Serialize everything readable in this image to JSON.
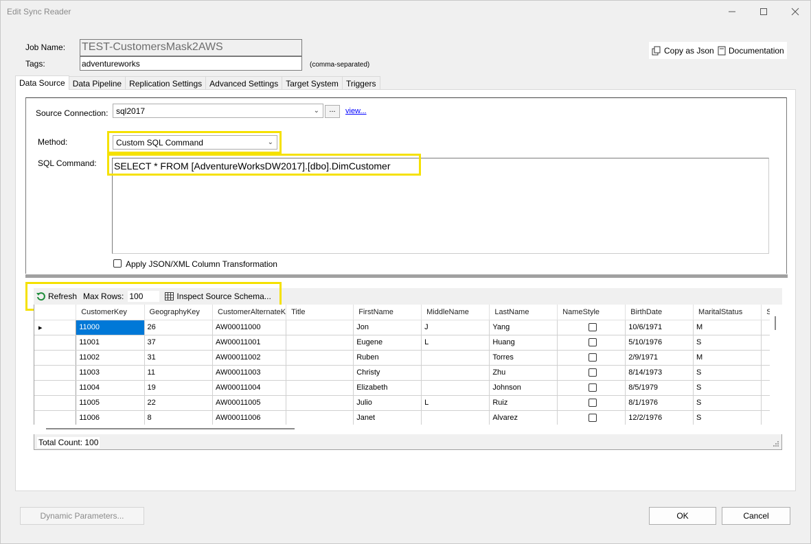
{
  "window": {
    "title": "Edit Sync Reader"
  },
  "form": {
    "job_name_label": "Job Name:",
    "job_name_value": "TEST-CustomersMask2AWS",
    "tags_label": "Tags:",
    "tags_value": "adventureworks",
    "tags_hint": "(comma-separated)",
    "copy_json_label": "Copy as Json",
    "documentation_label": "Documentation"
  },
  "tabs": [
    {
      "label": "Data Source",
      "active": true
    },
    {
      "label": "Data Pipeline"
    },
    {
      "label": "Replication Settings"
    },
    {
      "label": "Advanced Settings"
    },
    {
      "label": "Target System"
    },
    {
      "label": "Triggers"
    }
  ],
  "source": {
    "connection_label": "Source Connection:",
    "connection_value": "sql2017",
    "browse_label": "...",
    "view_link": "view...",
    "method_label": "Method:",
    "method_value": "Custom SQL Command",
    "sql_label": "SQL Command:",
    "sql_value": "SELECT * FROM [AdventureWorksDW2017].[dbo].DimCustomer",
    "transform_label": "Apply JSON/XML Column Transformation"
  },
  "toolbar": {
    "refresh_label": "Refresh",
    "max_rows_label": "Max Rows:",
    "max_rows_value": "100",
    "inspect_label": "Inspect Source Schema..."
  },
  "grid": {
    "columns": [
      "CustomerKey",
      "GeographyKey",
      "CustomerAlternateK",
      "Title",
      "FirstName",
      "MiddleName",
      "LastName",
      "NameStyle",
      "BirthDate",
      "MaritalStatus",
      "S"
    ],
    "rows": [
      [
        "11000",
        "26",
        "AW00011000",
        "",
        "Jon",
        "J",
        "Yang",
        "",
        "10/6/1971",
        "M",
        ""
      ],
      [
        "11001",
        "37",
        "AW00011001",
        "",
        "Eugene",
        "L",
        "Huang",
        "",
        "5/10/1976",
        "S",
        ""
      ],
      [
        "11002",
        "31",
        "AW00011002",
        "",
        "Ruben",
        "",
        "Torres",
        "",
        "2/9/1971",
        "M",
        ""
      ],
      [
        "11003",
        "11",
        "AW00011003",
        "",
        "Christy",
        "",
        "Zhu",
        "",
        "8/14/1973",
        "S",
        ""
      ],
      [
        "11004",
        "19",
        "AW00011004",
        "",
        "Elizabeth",
        "",
        "Johnson",
        "",
        "8/5/1979",
        "S",
        ""
      ],
      [
        "11005",
        "22",
        "AW00011005",
        "",
        "Julio",
        "L",
        "Ruiz",
        "",
        "8/1/1976",
        "S",
        ""
      ],
      [
        "11006",
        "8",
        "AW00011006",
        "",
        "Janet",
        "",
        "Alvarez",
        "",
        "12/2/1976",
        "S",
        ""
      ]
    ],
    "total_count": "Total Count: 100"
  },
  "footer": {
    "dynamic_params_label": "Dynamic Parameters...",
    "ok_label": "OK",
    "cancel_label": "Cancel"
  },
  "colors": {
    "highlight": "#f5e100",
    "selection": "#0078d7",
    "link": "#0000ff"
  }
}
